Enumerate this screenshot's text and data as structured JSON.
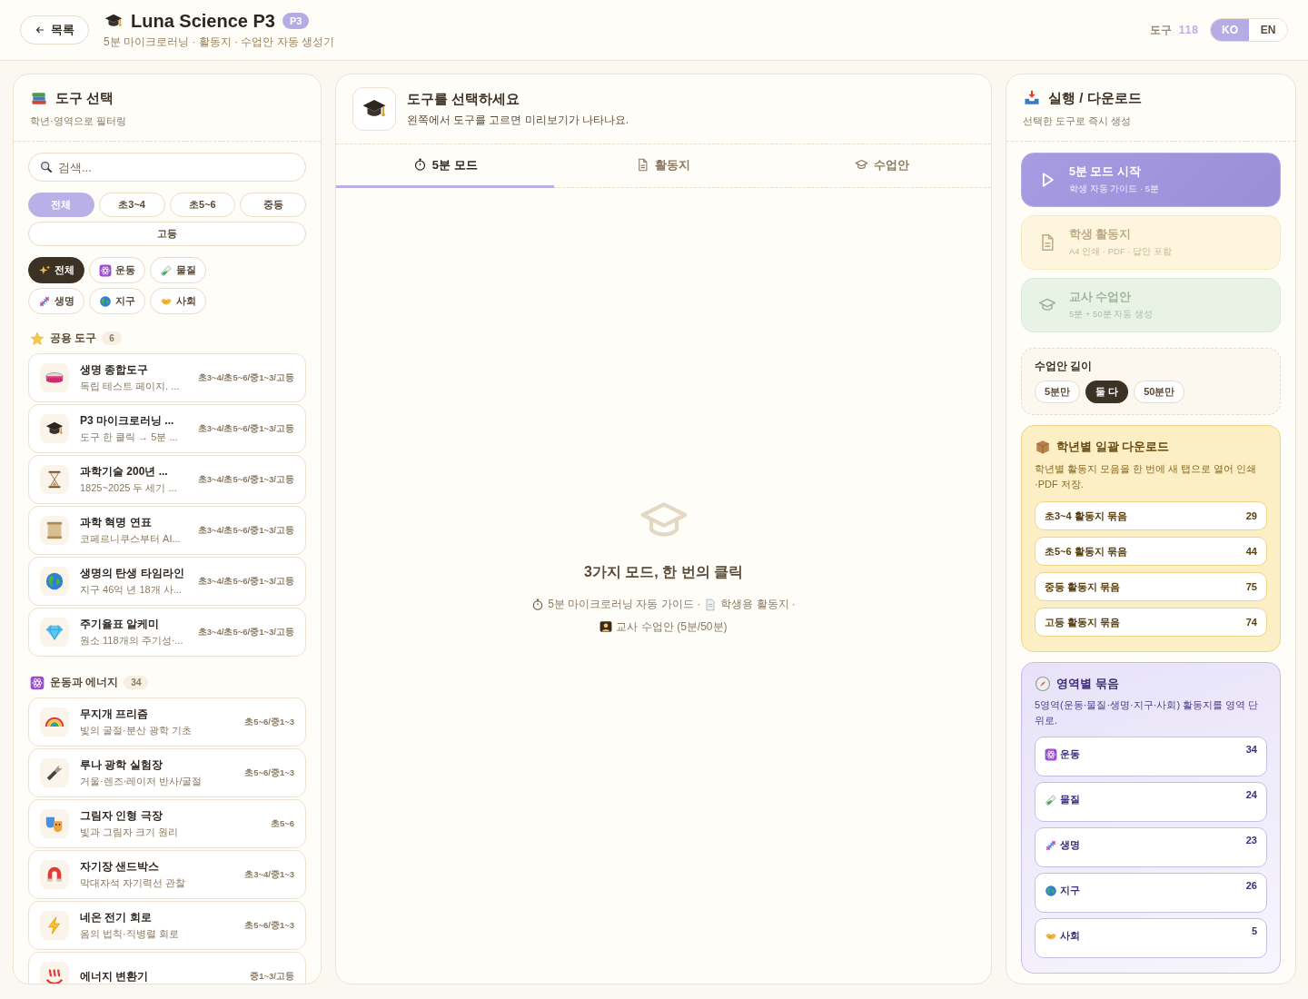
{
  "header": {
    "back_button": "목록",
    "title": "Luna Science P3",
    "badge": "P3",
    "subtitle": "5분 마이크로러닝 · 활동지 · 수업안 자동 생성기",
    "tool_count_label": "도구",
    "tool_count": "118",
    "languages": [
      {
        "label": "KO",
        "selected": true
      },
      {
        "label": "EN",
        "selected": false
      }
    ]
  },
  "tool_panel": {
    "title": "도구 선택",
    "subtitle": "학년·영역으로 필터링",
    "search": {
      "placeholder": "검색..."
    },
    "grade_filters": [
      {
        "label": "전체",
        "selected": true
      },
      {
        "label": "초3~4",
        "selected": false
      },
      {
        "label": "초5~6",
        "selected": false
      },
      {
        "label": "중등",
        "selected": false
      },
      {
        "label": "고등",
        "selected": false
      }
    ],
    "domain_filters": [
      {
        "label": "전체",
        "selected": true
      },
      {
        "label": "운동",
        "selected": false
      },
      {
        "label": "물질",
        "selected": false
      },
      {
        "label": "생명",
        "selected": false
      },
      {
        "label": "지구",
        "selected": false
      },
      {
        "label": "사회",
        "selected": false
      }
    ],
    "sections": [
      {
        "title": "공용 도구",
        "count": "6",
        "tools": [
          {
            "name": "생명 종합도구",
            "description": "독립 테스트 페이지. ...",
            "grades": "초3~4/초5~6/중1~3/고등"
          },
          {
            "name": "P3 마이크로러닝 ...",
            "description": "도구 한 클릭 → 5분 ...",
            "grades": "초3~4/초5~6/중1~3/고등"
          },
          {
            "name": "과학기술 200년 ...",
            "description": "1825~2025 두 세기 ...",
            "grades": "초3~4/초5~6/중1~3/고등"
          },
          {
            "name": "과학 혁명 연표",
            "description": "코페르니쿠스부터 AI...",
            "grades": "초3~4/초5~6/중1~3/고등"
          },
          {
            "name": "생명의 탄생 타임라인",
            "description": "지구 46억 년 18개 사...",
            "grades": "초3~4/초5~6/중1~3/고등"
          },
          {
            "name": "주기율표 알케미",
            "description": "원소 118개의 주기성·...",
            "grades": "초3~4/초5~6/중1~3/고등"
          }
        ]
      },
      {
        "title": "운동과 에너지",
        "count": "34",
        "tools": [
          {
            "name": "무지개 프리즘",
            "description": "빛의 굴절·분산 광학 기초",
            "grades": "초5~6/중1~3"
          },
          {
            "name": "루나 광학 실험장",
            "description": "거울·렌즈·레이저 반사/굴절",
            "grades": "초5~6/중1~3"
          },
          {
            "name": "그림자 인형 극장",
            "description": "빛과 그림자 크기 원리",
            "grades": "초5~6"
          },
          {
            "name": "자기장 샌드박스",
            "description": "막대자석 자기력선 관찰",
            "grades": "초3~4/중1~3"
          },
          {
            "name": "네온 전기 회로",
            "description": "옴의 법칙·직병렬 회로",
            "grades": "초5~6/중1~3"
          },
          {
            "name": "에너지 변환기",
            "grades": "중1~3/고등"
          }
        ]
      }
    ]
  },
  "preview_panel": {
    "title": "도구를 선택하세요",
    "subtitle": "왼쪽에서 도구를 고르면 미리보기가 나타나요.",
    "tabs": [
      {
        "kind": "timer",
        "label": "5분 모드",
        "selected": true
      },
      {
        "kind": "doc",
        "label": "활동지",
        "selected": false
      },
      {
        "kind": "cap",
        "label": "수업안",
        "selected": false
      }
    ],
    "empty_state": {
      "title": "3가지 모드, 한 번의 클릭",
      "parts": [
        {
          "kind": "timer",
          "text": "5분 마이크로러닝 자동 가이드 ·"
        },
        {
          "kind": "doc",
          "text": "학생용 활동지 ·"
        },
        {
          "kind": "teacher",
          "text": "교사 수업안 (5분/50분)"
        }
      ]
    }
  },
  "action_panel": {
    "title": "실행 / 다운로드",
    "subtitle": "선택한 도구로 즉시 생성",
    "actions": [
      {
        "kind": "play",
        "title": "5분 모드 시작",
        "subtitle": "학생 자동 가이드 · 5분",
        "disabled": true
      },
      {
        "kind": "doc",
        "title": "학생 활동지",
        "subtitle": "A4 인쇄 · PDF · 답안 포함",
        "disabled": true
      },
      {
        "kind": "cap",
        "title": "교사 수업안",
        "subtitle": "5분 + 50분 자동 생성",
        "disabled": true
      }
    ],
    "lesson_length": {
      "title": "수업안 길이",
      "options": [
        {
          "label": "5분만",
          "selected": false
        },
        {
          "label": "둘 다",
          "selected": true
        },
        {
          "label": "50분만",
          "selected": false
        }
      ]
    },
    "grade_bundle": {
      "title": "학년별 일괄 다운로드",
      "description": "학년별 활동지 모음을 한 번에 새 탭으로 열어 인쇄·PDF 저장.",
      "items": [
        {
          "label": "초3~4 활동지 묶음",
          "count": "29"
        },
        {
          "label": "초5~6 활동지 묶음",
          "count": "44"
        },
        {
          "label": "중등 활동지 묶음",
          "count": "75"
        },
        {
          "label": "고등 활동지 묶음",
          "count": "74"
        }
      ]
    },
    "domain_bundle": {
      "title": "영역별 묶음",
      "description": "5영역(운동·물질·생명·지구·사회) 활동지를 영역 단위로.",
      "items": [
        {
          "label": "운동",
          "count": "34"
        },
        {
          "label": "물질",
          "count": "24"
        },
        {
          "label": "생명",
          "count": "23"
        },
        {
          "label": "지구",
          "count": "26"
        },
        {
          "label": "사회",
          "count": "5"
        }
      ]
    }
  }
}
